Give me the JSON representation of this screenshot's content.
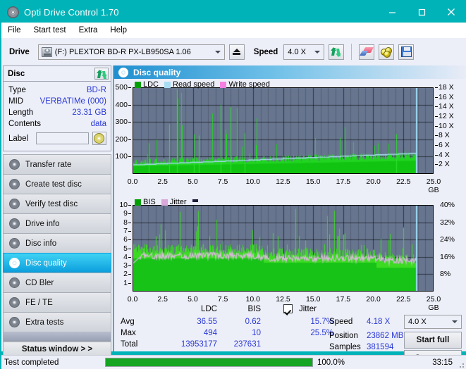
{
  "window": {
    "title": "Opti Drive Control 1.70",
    "icon": "disc-icon",
    "minimize": "minimize-icon",
    "maximize": "maximize-icon",
    "close": "close-icon"
  },
  "menu": {
    "items": [
      "File",
      "Start test",
      "Extra",
      "Help"
    ]
  },
  "toolbar": {
    "drive_label": "Drive",
    "drive_value": "(F:)  PLEXTOR BD-R  PX-LB950SA 1.06",
    "eject_icon": "eject-icon",
    "speed_label": "Speed",
    "speed_value": "4.0 X",
    "refresh_icon": "refresh-icon",
    "erase_icon": "eraser-icon",
    "bitsetting_icon": "peanut-icon",
    "save_icon": "save-icon"
  },
  "disc_panel": {
    "title": "Disc",
    "refresh_icon": "refresh-icon",
    "rows": [
      {
        "key": "Type",
        "value": "BD-R"
      },
      {
        "key": "MID",
        "value": "VERBATIMe (000)"
      },
      {
        "key": "Length",
        "value": "23.31 GB"
      },
      {
        "key": "Contents",
        "value": "data"
      }
    ],
    "label_key": "Label",
    "label_value": "",
    "label_placeholder": "",
    "label_button_icon": "disc-icon"
  },
  "sidebar": {
    "items": [
      {
        "label": "Transfer rate",
        "icon": "disc-transfer-icon",
        "active": false
      },
      {
        "label": "Create test disc",
        "icon": "disc-create-icon",
        "active": false
      },
      {
        "label": "Verify test disc",
        "icon": "disc-verify-icon",
        "active": false
      },
      {
        "label": "Drive info",
        "icon": "disc-drive-icon",
        "active": false
      },
      {
        "label": "Disc info",
        "icon": "disc-info-icon",
        "active": false
      },
      {
        "label": "Disc quality",
        "icon": "disc-quality-icon",
        "active": true
      },
      {
        "label": "CD Bler",
        "icon": "disc-bler-icon",
        "active": false
      },
      {
        "label": "FE / TE",
        "icon": "disc-fete-icon",
        "active": false
      },
      {
        "label": "Extra tests",
        "icon": "disc-extra-icon",
        "active": false
      }
    ],
    "status_window": "Status window > >"
  },
  "main": {
    "header": "Disc quality",
    "header_icon": "disc-quality-icon"
  },
  "chart_data": [
    {
      "type": "area",
      "name": "top-chart",
      "title": "",
      "xlabel": "GB",
      "ylabel": "",
      "ylim": [
        0,
        500
      ],
      "yticks": [
        100,
        200,
        300,
        400,
        500
      ],
      "xlim": [
        0.0,
        25.0
      ],
      "xticks": [
        "0.0",
        "2.5",
        "5.0",
        "7.5",
        "10.0",
        "12.5",
        "15.0",
        "17.5",
        "20.0",
        "22.5",
        "25.0 GB"
      ],
      "y2lim": [
        0,
        18
      ],
      "y2ticks": [
        "2 X",
        "4 X",
        "6 X",
        "8 X",
        "10 X",
        "12 X",
        "14 X",
        "16 X",
        "18 X"
      ],
      "grid": true,
      "legend": [
        {
          "label": "LDC",
          "color": "#00a000"
        },
        {
          "label": "Read speed",
          "color": "#a8dcf5"
        },
        {
          "label": "Write speed",
          "color": "#f57fe0"
        }
      ],
      "series": [
        {
          "name": "LDC",
          "color": "#1ecb1e",
          "type": "bars",
          "baseline": 0,
          "note": "dense green spikes, base ~50-90, peaks to 494"
        },
        {
          "name": "Read speed",
          "color": "#a8dcf5",
          "type": "line",
          "note": "rises 1.8X to 4.2X across disc, stepped"
        }
      ]
    },
    {
      "type": "area",
      "name": "bottom-chart",
      "title": "",
      "xlabel": "GB",
      "ylabel": "",
      "ylim": [
        0,
        10
      ],
      "yticks": [
        1,
        2,
        3,
        4,
        5,
        6,
        7,
        8,
        9,
        10
      ],
      "xlim": [
        0.0,
        25.0
      ],
      "xticks": [
        "0.0",
        "2.5",
        "5.0",
        "7.5",
        "10.0",
        "12.5",
        "15.0",
        "17.5",
        "20.0",
        "22.5",
        "25.0 GB"
      ],
      "y2lim": [
        0,
        40
      ],
      "y2ticks": [
        "8%",
        "16%",
        "24%",
        "32%",
        "40%"
      ],
      "grid": true,
      "legend": [
        {
          "label": "BIS",
          "color": "#00a000"
        },
        {
          "label": "Jitter",
          "color": "#d9a8d9"
        }
      ],
      "series": [
        {
          "name": "BIS",
          "color": "#33cc33",
          "type": "bars",
          "baseline": 0,
          "note": "base ~4-6, peaks to 10"
        },
        {
          "name": "Jitter",
          "color": "#d9b6dd",
          "type": "line",
          "note": "around 15-17%, avg 15.7%, max 25.5%"
        }
      ]
    }
  ],
  "stats": {
    "col_headers": [
      "LDC",
      "BIS"
    ],
    "jitter_label": "Jitter",
    "jitter_checked": true,
    "rows": [
      {
        "label": "Avg",
        "ldc": "36.55",
        "bis": "0.62",
        "jitter": "15.7%"
      },
      {
        "label": "Max",
        "ldc": "494",
        "bis": "10",
        "jitter": "25.5%"
      },
      {
        "label": "Total",
        "ldc": "13953177",
        "bis": "237631",
        "jitter": ""
      }
    ],
    "speed_label": "Speed",
    "speed_value": "4.18 X",
    "position_label": "Position",
    "position_value": "23862 MB",
    "samples_label": "Samples",
    "samples_value": "381594",
    "speed_select": "4.0 X",
    "start_full": "Start full",
    "start_part": "Start part"
  },
  "statusbar": {
    "text": "Test completed",
    "progress_percent": 100.0,
    "progress_label": "100.0%",
    "elapsed": "33:15"
  }
}
